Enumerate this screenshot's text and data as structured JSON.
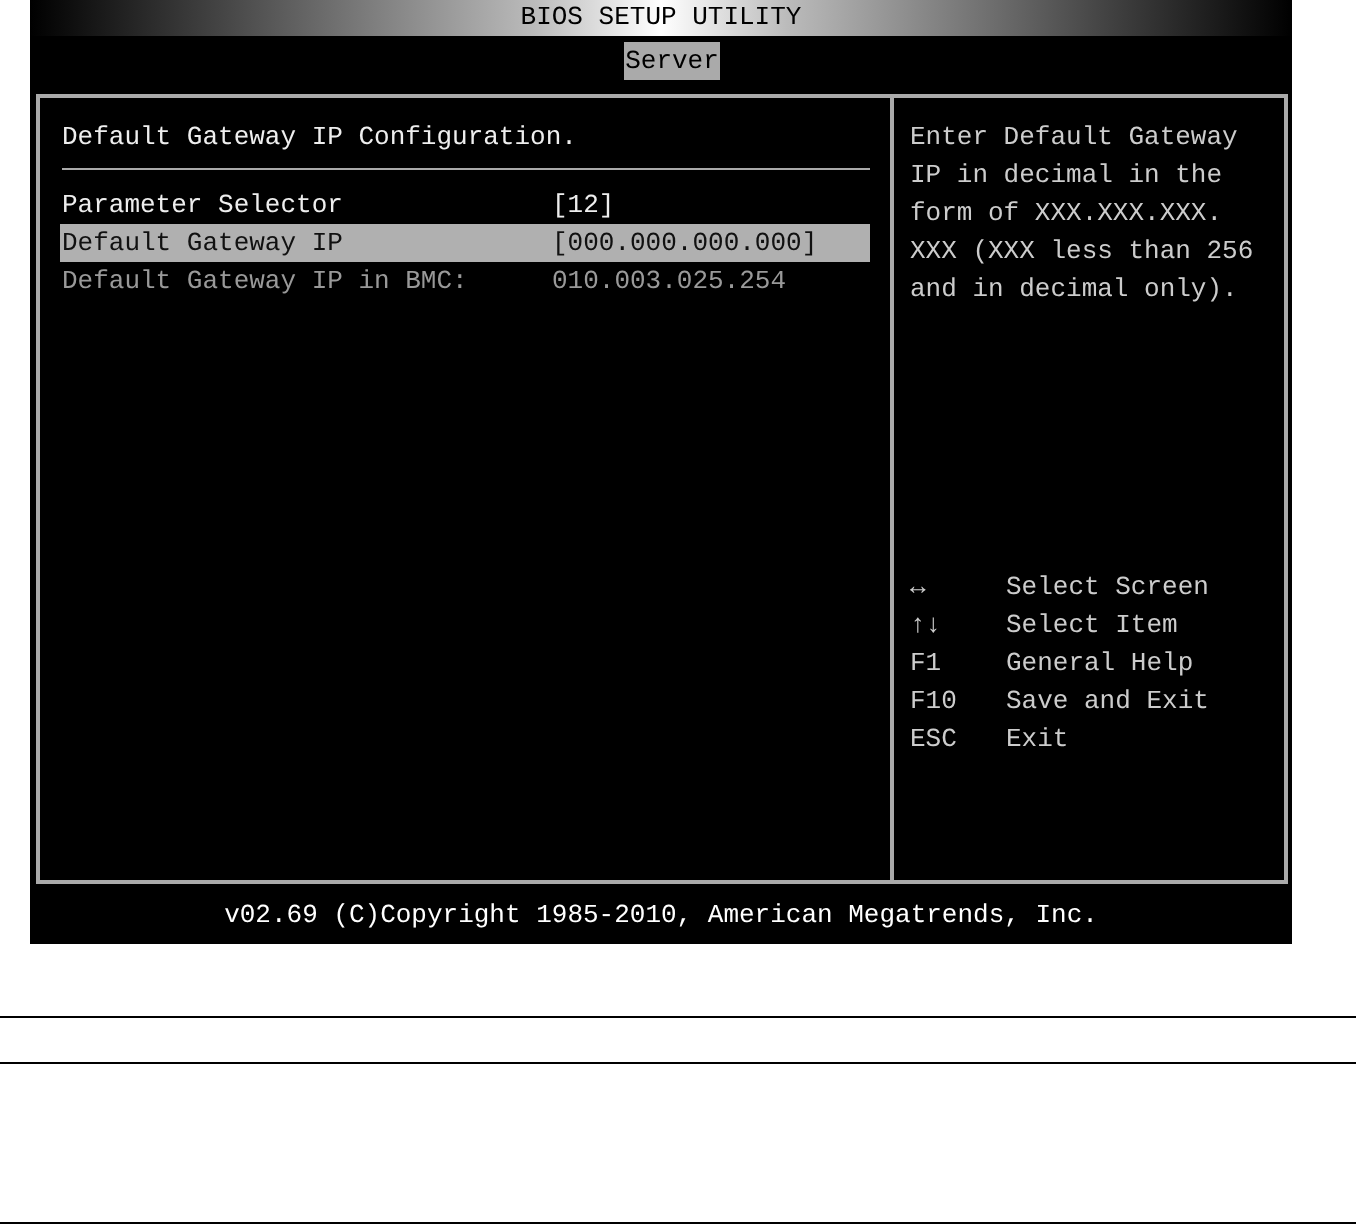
{
  "window": {
    "title": "BIOS SETUP UTILITY"
  },
  "tabs": [
    {
      "label": "Server",
      "selected": true
    }
  ],
  "section_title": "Default Gateway IP Configuration.",
  "settings": [
    {
      "label": "Parameter Selector",
      "value": "[12]",
      "selected": false,
      "disabled": false
    },
    {
      "label": "Default Gateway IP",
      "value": "[000.000.000.000]",
      "selected": true,
      "disabled": false
    },
    {
      "label": "Default Gateway IP in BMC:",
      "value": "010.003.025.254",
      "selected": false,
      "disabled": true
    }
  ],
  "help": "Enter Default Gateway\nIP in decimal in the\nform of XXX.XXX.XXX.\nXXX (XXX less than 256\nand in decimal only).",
  "keys": [
    {
      "key": "↔",
      "action": "Select Screen"
    },
    {
      "key": "↑↓",
      "action": "Select Item"
    },
    {
      "key": "F1",
      "action": "General Help"
    },
    {
      "key": "F10",
      "action": "Save and Exit"
    },
    {
      "key": "ESC",
      "action": "Exit"
    }
  ],
  "status_bar": "v02.69 (C)Copyright 1985-2010, American Megatrends, Inc."
}
